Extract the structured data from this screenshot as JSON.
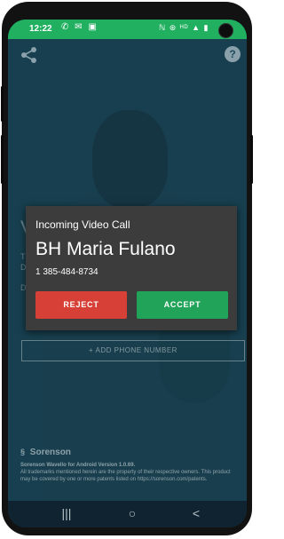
{
  "status_bar": {
    "time": "12:22",
    "left_icons": "✆ ✉ ▣",
    "right_icons": "ℕ ⊛ ᴴᴰ ▲ ▮"
  },
  "top_bar": {
    "help_glyph": "?"
  },
  "background": {
    "letter_v": "V",
    "letter_t": "T",
    "letter_d1": "D",
    "letter_d2": "D",
    "add_phone_label": "+ ADD PHONE NUMBER"
  },
  "dialog": {
    "header": "Incoming Video Call",
    "caller_name": "BH Maria Fulano",
    "caller_number": "1 385-484-8734",
    "reject_label": "REJECT",
    "accept_label": "ACCEPT",
    "reject_color": "#d64037",
    "accept_color": "#22a35a"
  },
  "footer": {
    "brand": "Sorenson",
    "version": "Sorenson Wavello for Android Version 1.0.69.",
    "legal": "All trademarks mentioned herein are the property of their respective owners. This product may be covered by one or more patents listed on https://sorenson.com/patents."
  },
  "nav_bar": {
    "recents": "|||",
    "home": "○",
    "back": "<"
  },
  "colors": {
    "status_bar": "#21b060",
    "screen_bg": "#1c4a5c",
    "dialog_bg": "#3c3c3c"
  }
}
